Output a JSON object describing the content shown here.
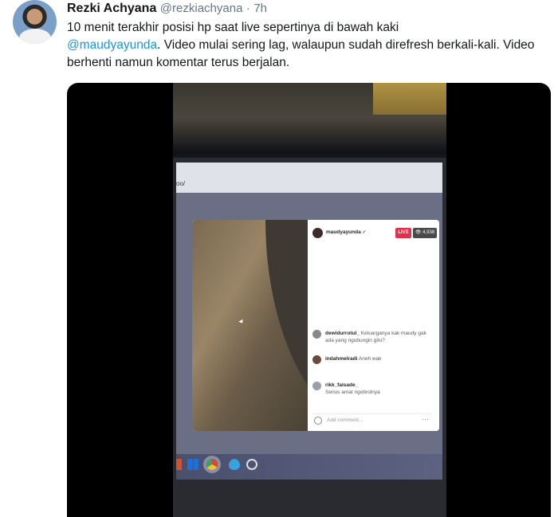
{
  "tweet": {
    "display_name": "Rezki Achyana",
    "handle": "@rezkiachyana",
    "separator": "·",
    "time": "7h",
    "text_part1": "10 menit terakhir posisi hp saat live sepertinya di bawah kaki",
    "mention": "@maudyayunda",
    "text_part2": ". Video mulai sering lag, walaupun sudah direfresh berkali-kali. Video berhenti namun komentar terus berjalan."
  },
  "video": {
    "address_fragment": "oo/",
    "instagram": {
      "username": "maudyayunda",
      "verified_icon": "verified-badge-icon",
      "live_label": "LIVE",
      "viewers": "👁 4,938",
      "comments": [
        {
          "user": "dewidurrotul_",
          "text": "Keluarganya kak maudy gak ada yang ngubungin gitu?"
        },
        {
          "user": "indahmelradi",
          "text": "Aneh wak"
        },
        {
          "user": "rikk_faisade_",
          "text": "Serius amat ngobrolnya"
        }
      ],
      "comment_placeholder": "Add comment...",
      "more_icon": "more-dots-icon"
    }
  },
  "colors": {
    "mention": "#1b95e0",
    "live": "#e0304b",
    "name": "#14171a",
    "muted": "#657786"
  }
}
